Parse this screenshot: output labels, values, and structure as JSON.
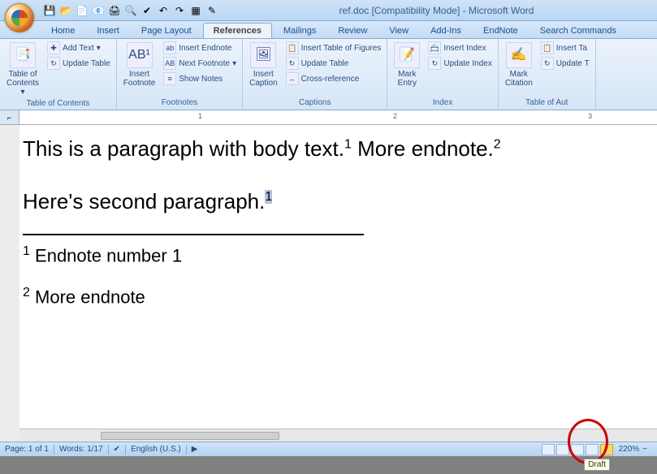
{
  "title": "ref.doc [Compatibility Mode] - Microsoft Word",
  "qat": {
    "save": "💾",
    "open": "📂",
    "new": "📄",
    "mail": "📧",
    "print": "🖨",
    "preview": "🔍",
    "spell": "✔",
    "undo": "↶",
    "redo": "↷",
    "table": "▦",
    "review": "✎"
  },
  "tabs": [
    "Home",
    "Insert",
    "Page Layout",
    "References",
    "Mailings",
    "Review",
    "View",
    "Add-Ins",
    "EndNote",
    "Search Commands"
  ],
  "active_tab": "References",
  "ribbon": {
    "g1": {
      "label": "Table of Contents",
      "toc": "Table of\nContents",
      "addtext": "Add Text",
      "update": "Update Table"
    },
    "g2": {
      "label": "Footnotes",
      "insert": "Insert\nFootnote",
      "ab": "AB¹",
      "endnote": "Insert Endnote",
      "next": "Next Footnote",
      "show": "Show Notes"
    },
    "g3": {
      "label": "Captions",
      "caption": "Insert\nCaption",
      "tof": "Insert Table of Figures",
      "update": "Update Table",
      "xref": "Cross-reference"
    },
    "g4": {
      "label": "Index",
      "mark": "Mark\nEntry",
      "insert": "Insert Index",
      "update": "Update Index"
    },
    "g5": {
      "label": "Table of Aut",
      "mark": "Mark\nCitation",
      "insert": "Insert Ta",
      "update": "Update T"
    }
  },
  "ruler": [
    "1",
    "2",
    "3"
  ],
  "document": {
    "p1a": "This is a paragraph with body text.",
    "p1b": "  More endnote.",
    "p2": "Here's second paragraph.",
    "en1": "Endnote number 1",
    "en2": "More endnote"
  },
  "status": {
    "page": "Page: 1 of 1",
    "words": "Words: 1/17",
    "lang": "English (U.S.)",
    "zoom": "220%"
  },
  "tooltip": "Draft"
}
